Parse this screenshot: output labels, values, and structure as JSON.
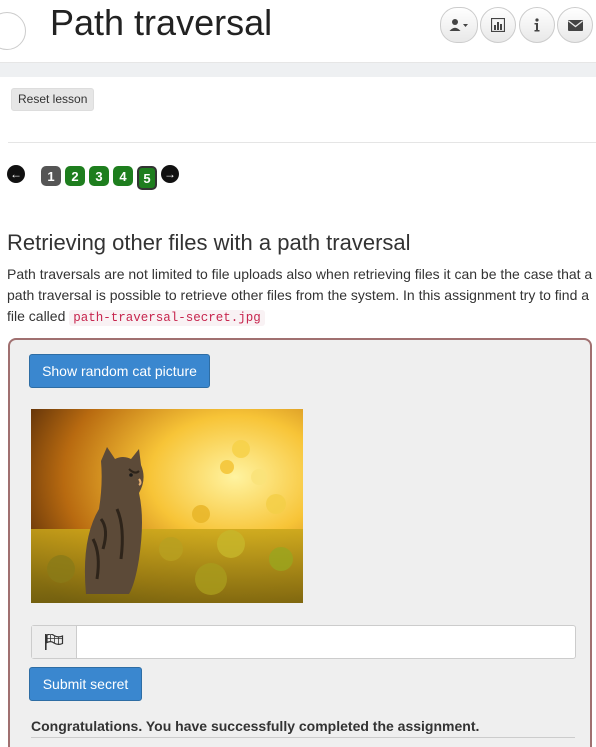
{
  "header": {
    "title": "Path traversal",
    "buttons": [
      {
        "icon": "user-icon"
      },
      {
        "icon": "chart-icon"
      },
      {
        "icon": "info-icon"
      },
      {
        "icon": "envelope-icon"
      }
    ]
  },
  "lesson": {
    "reset_label": "Reset lesson"
  },
  "pagination": {
    "pages": [
      "1",
      "2",
      "3",
      "4",
      "5"
    ],
    "current": "1",
    "active": "5"
  },
  "content": {
    "heading": "Retrieving other files with a path traversal",
    "description_before": "Path traversals are not limited to file uploads also when retrieving files it can be the case that a path traversal is possible to retrieve other files from the system. In this assignment try to find a file called ",
    "secret_filename": "path-traversal-secret.jpg"
  },
  "assignment": {
    "show_cat_label": "Show random cat picture",
    "secret_input_value": "",
    "submit_label": "Submit secret",
    "success_message": "Congratulations. You have successfully completed the assignment."
  },
  "colors": {
    "button_blue": "#3a87cf",
    "page_done": "#1e7e1e",
    "page_current": "#555555",
    "secret_code": "#c7254e"
  }
}
